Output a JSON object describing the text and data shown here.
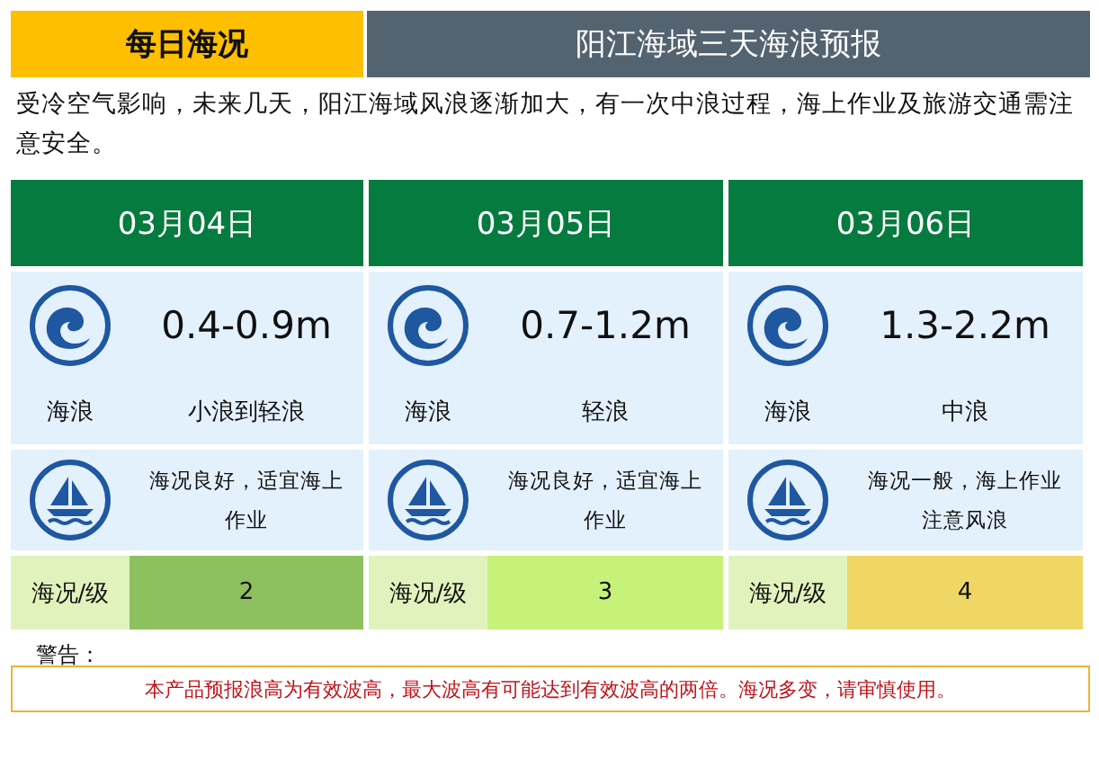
{
  "header": {
    "tab": "每日海况",
    "title": "阳江海域三天海浪预报"
  },
  "summary": "受冷空气影响，未来几天，阳江海域风浪逐渐加大，有一次中浪过程，海上作业及旅游交通需注意安全。",
  "days": [
    {
      "date": "03月04日",
      "wave_height": "0.4-0.9m",
      "wave_label": "海浪",
      "wave_grade": "小浪到轻浪",
      "advice": "海况良好，适宜海上作业",
      "level_label": "海况/级",
      "level_value": "2",
      "color": "#8dc15f"
    },
    {
      "date": "03月05日",
      "wave_height": "0.7-1.2m",
      "wave_label": "海浪",
      "wave_grade": "轻浪",
      "advice": "海况良好，适宜海上作业",
      "level_label": "海况/级",
      "level_value": "3",
      "color": "#c6f27a"
    },
    {
      "date": "03月06日",
      "wave_height": "1.3-2.2m",
      "wave_label": "海浪",
      "wave_grade": "中浪",
      "advice": "海况一般，海上作业注意风浪",
      "level_label": "海况/级",
      "level_value": "4",
      "color": "#f0d765"
    }
  ],
  "warning": {
    "label": "警告：",
    "text": "本产品预报浪高为有效波高，最大波高有可能达到有效波高的两倍。海况多变，请审慎使用。"
  }
}
